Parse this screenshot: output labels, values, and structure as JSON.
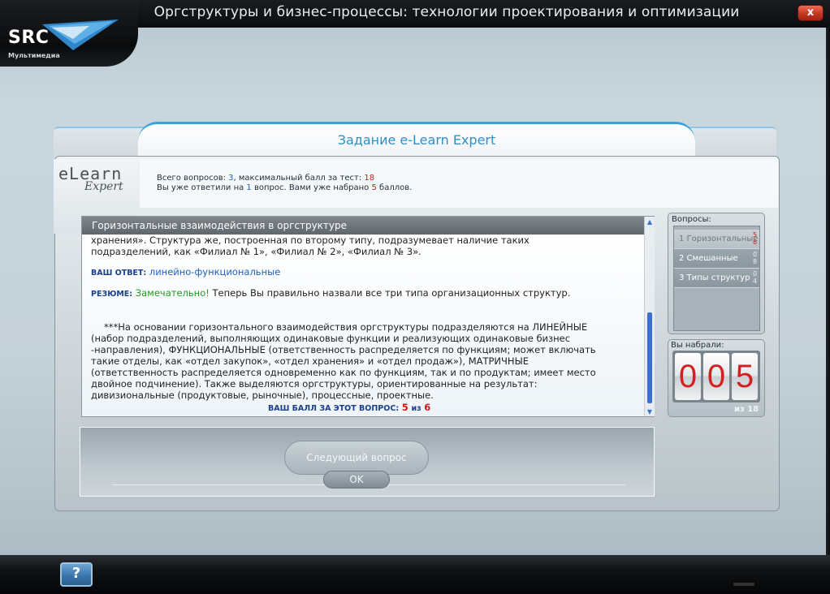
{
  "app": {
    "title": "Оргструктуры и бизнес-процессы: технологии проектирования и оптимизации",
    "logo_text": "SRC",
    "logo_subtitle": "Мультимедиа",
    "close_label": "x",
    "help_label": "?"
  },
  "task": {
    "title": "Задание e-Learn Expert",
    "logo_line1": "eLearn",
    "logo_line2": "Expert",
    "info_line1_prefix": "Всего вопросов: ",
    "total_questions": "3",
    "info_line1_mid": ", максимальный балл за тест: ",
    "max_score": "18",
    "info_line2_prefix": "Вы уже ответили на ",
    "answered": "1",
    "info_line2_mid": " вопрос. Вами уже набрано ",
    "scored": "5",
    "info_line2_suffix": " баллов."
  },
  "content": {
    "header": "Горизонтальные взаимодействия в оргструктуре",
    "line1": "хранения». Структура же, построенная по второму типу, подразумевает наличие таких",
    "line2": "подразделений, как «Филиал № 1», «Филиал № 2», «Филиал № 3».",
    "answer_label": "ВАШ ОТВЕТ:",
    "answer_value": "линейно-функциональные",
    "resume_label": "РЕЗЮМЕ:",
    "resume_praise": "Замечательно!",
    "resume_text": "Теперь Вы правильно назвали все три типа организационных структур.",
    "para": [
      "***На основании горизонтального взаимодействия оргструктуры подразделяются на ЛИНЕЙНЫЕ",
      "(набор подразделений, выполняющих одинаковые функции и реализующих одинаковые бизнес",
      "-направления), ФУНКЦИОНАЛЬНЫЕ (ответственность распределяется по функциям; может включать",
      "такие отделы, как «отдел закупок», «отдел хранения» и «отдел продаж»), МАТРИЧНЫЕ",
      "(ответственность распределяется одновременно как по функциям, так и по продуктам; имеет место",
      "двойное подчинение). Также выделяются оргструктуры, ориентированные на результат:",
      "дивизиональные (продуктовые, рыночные), процессные, проектные."
    ],
    "score_label": "ВАШ БАЛЛ ЗА ЭТОТ ВОПРОС:",
    "score_value": "5",
    "score_of": "из",
    "score_max": "6"
  },
  "nav": {
    "next_label": "Следующий вопрос",
    "ok_label": "OK"
  },
  "questions": {
    "title": "Вопросы:",
    "items": [
      {
        "label": "1  Горизонтальные",
        "score_top": "5",
        "score_bottom": "6"
      },
      {
        "label": "2  Смешанные",
        "score_top": "0",
        "score_bottom": "8"
      },
      {
        "label": "3  Типы структур",
        "score_top": "0",
        "score_bottom": "4"
      }
    ]
  },
  "score": {
    "title": "Вы набрали:",
    "digits": [
      "0",
      "0",
      "5"
    ],
    "of_total": "из 18"
  },
  "colors": {
    "accent_blue": "#2f8ec8",
    "score_red": "#d42020",
    "praise_green": "#1e9a1e"
  }
}
